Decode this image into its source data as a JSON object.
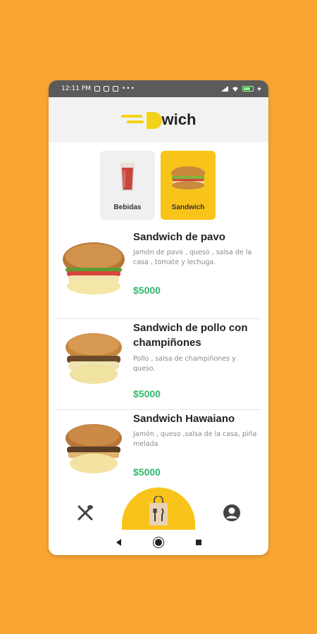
{
  "status_bar": {
    "time": "12:11 PM",
    "dots": "•••"
  },
  "header": {
    "logo_text": "wich"
  },
  "categories": [
    {
      "label": "Bebidas",
      "active": false
    },
    {
      "label": "Sandwich",
      "active": true
    }
  ],
  "products": [
    {
      "name": "Sandwich de pavo",
      "description": "Jamón de pavo , queso , salsa de la casa , tomate y lechuga.",
      "price": "$5000"
    },
    {
      "name": "Sandwich de pollo con champiñones",
      "description": "Pollo , salsa de champiñones y queso.",
      "price": "$5000"
    },
    {
      "name": "Sandwich Hawaiano",
      "description": "Jamón , queso ,salsa de la casa, piña melada",
      "price": "$5000"
    }
  ],
  "colors": {
    "background": "#f9a533",
    "accent": "#f9c41a",
    "price": "#2eb86b"
  },
  "nav": {
    "left_icon": "fork-knife-icon",
    "center_icon": "shopping-bag-icon",
    "right_icon": "user-icon"
  }
}
